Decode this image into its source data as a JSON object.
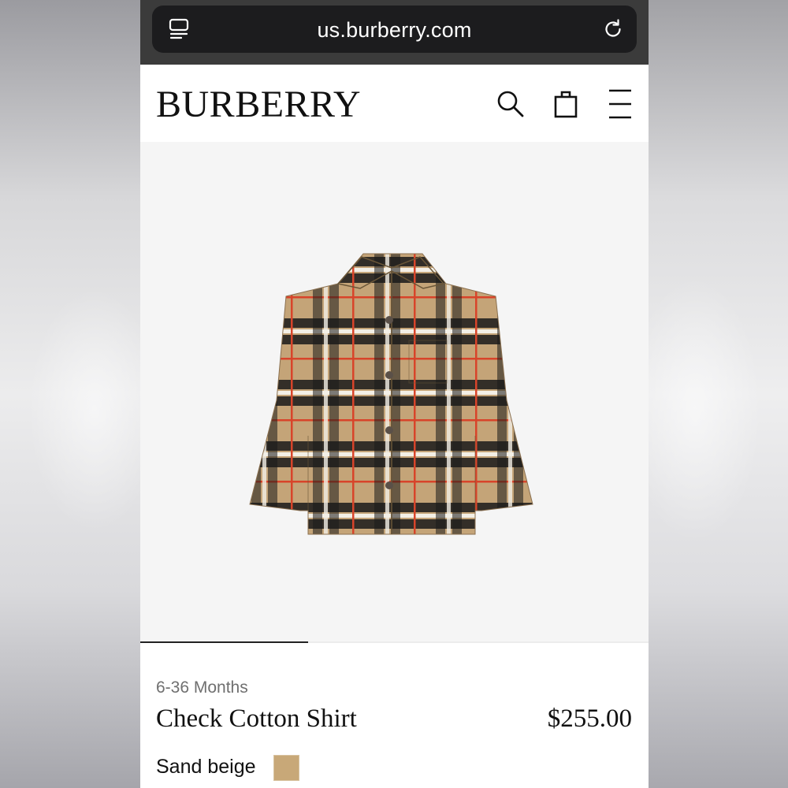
{
  "browser": {
    "url": "us.burberry.com",
    "reader_icon": "reader-mode-icon",
    "reload_icon": "reload-icon"
  },
  "header": {
    "logo": "BURBERRY",
    "icons": [
      "search-icon",
      "shopping-bag-icon",
      "menu-icon"
    ]
  },
  "product": {
    "age_range": "6-36 Months",
    "name": "Check Cotton Shirt",
    "price": "$255.00",
    "color": {
      "name": "Sand beige",
      "swatch": "#c8a878"
    },
    "image": "check-cotton-shirt"
  },
  "gallery": {
    "slide_fraction": 0.33
  },
  "colors": {
    "browser_bar": "#3b3b3b",
    "url_pill": "#1c1c1e",
    "gallery_bg": "#f5f5f5",
    "check_base": "#c4a478",
    "check_red": "#d8442a",
    "check_black": "#1a1a1a"
  }
}
